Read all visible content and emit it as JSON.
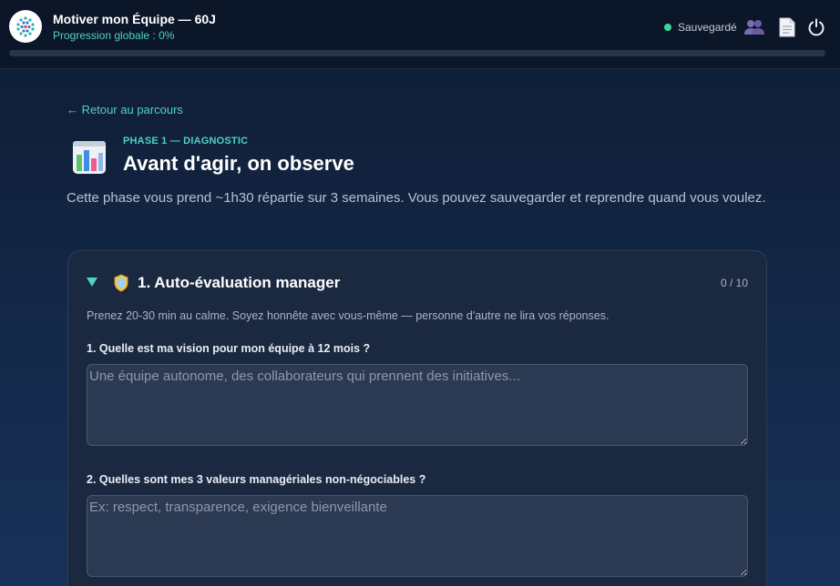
{
  "header": {
    "title": "Motiver mon Équipe — 60J",
    "progress_label": "Progression globale : 0%",
    "progress_value": 0,
    "save_status": "Sauvegardé",
    "icons": [
      "team-icon",
      "document-icon",
      "power-icon"
    ]
  },
  "nav": {
    "back_label": "← Retour au parcours"
  },
  "phase": {
    "tag": "PHASE 1 — DIAGNOSTIC",
    "title": "Avant d'agir, on observe",
    "description": "Cette phase vous prend ~1h30 répartie sur 3 semaines. Vous pouvez sauvegarder et reprendre quand vous voulez."
  },
  "section": {
    "title": "1. Auto-évaluation manager",
    "count": "0 / 10",
    "hint": "Prenez 20-30 min au calme. Soyez honnête avec vous-même — personne d'autre ne lira vos réponses.",
    "questions": [
      {
        "label": "1. Quelle est ma vision pour mon équipe à 12 mois ?",
        "value": "",
        "placeholder": "Une équipe autonome, des collaborateurs qui prennent des initiatives..."
      },
      {
        "label": "2. Quelles sont mes 3 valeurs managériales non-négociables ?",
        "value": "",
        "placeholder": "Ex: respect, transparence, exigence bienveillante"
      }
    ]
  },
  "colors": {
    "accent": "#4fd1c5",
    "saved_dot": "#3dd598",
    "background": "#14294a",
    "card": "#1a2940"
  }
}
